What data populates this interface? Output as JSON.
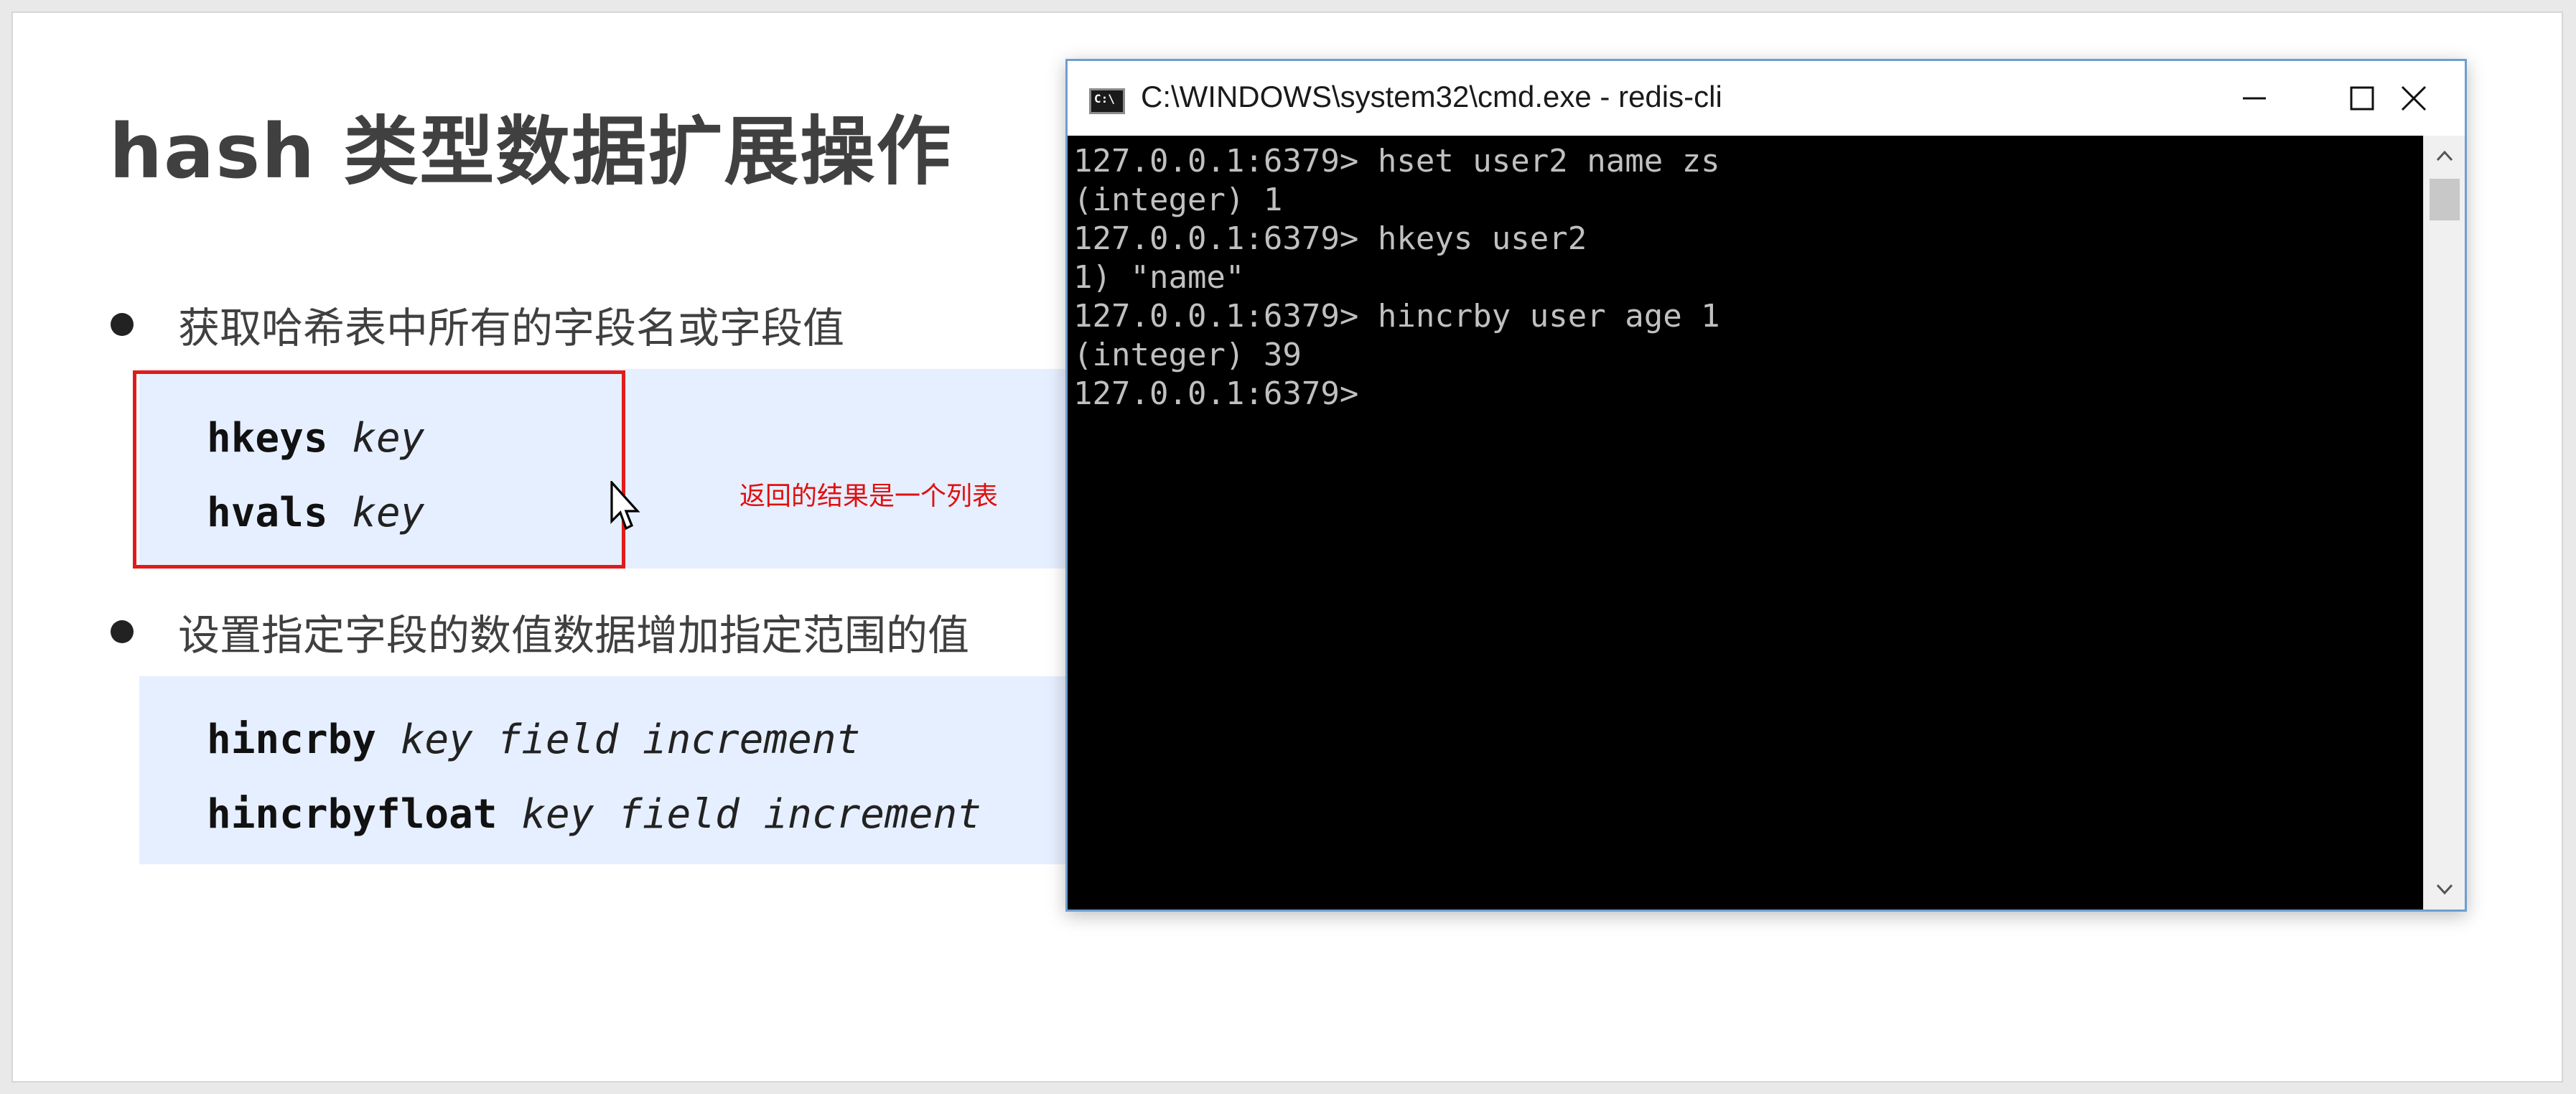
{
  "slide": {
    "title": "hash 类型数据扩展操作",
    "bullets": [
      "获取哈希表中所有的字段名或字段值",
      "设置指定字段的数值数据增加指定范围的值"
    ],
    "code_block_1": [
      {
        "cmd": "hkeys",
        "args": "key"
      },
      {
        "cmd": "hvals",
        "args": "key"
      }
    ],
    "code_block_2": [
      {
        "cmd": "hincrby",
        "args": "key field increment"
      },
      {
        "cmd": "hincrbyfloat",
        "args": "key field increment"
      }
    ],
    "annotation": "返回的结果是一个列表",
    "colors": {
      "highlight": "#e01b1b",
      "codebox_bg": "#e6efff",
      "text": "#404040"
    }
  },
  "window": {
    "title": "C:\\WINDOWS\\system32\\cmd.exe - redis-cli",
    "icon": "cmd-icon",
    "icon_text": "C:\\",
    "buttons": [
      "minimize",
      "maximize",
      "close"
    ],
    "console_lines": [
      "127.0.0.1:6379> hset user2 name zs",
      "(integer) 1",
      "127.0.0.1:6379> hkeys user2",
      "1) \"name\"",
      "127.0.0.1:6379> hincrby user age 1",
      "(integer) 39",
      "127.0.0.1:6379>"
    ]
  }
}
